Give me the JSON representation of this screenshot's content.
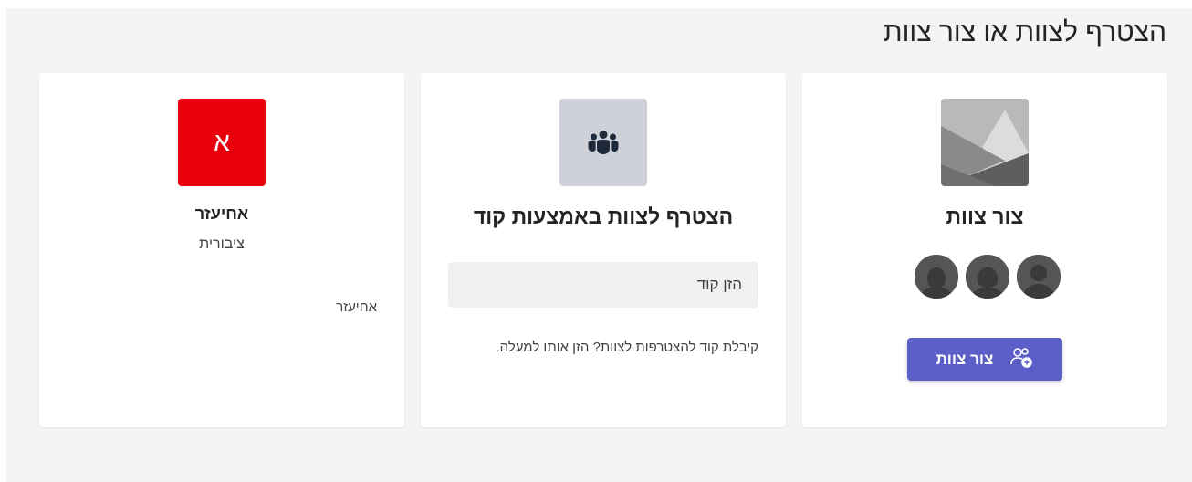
{
  "page": {
    "title": "הצטרף לצוות או צור צוות"
  },
  "create_card": {
    "title": "צור צוות",
    "button_label": "צור צוות",
    "icon": "image-placeholder-icon",
    "button_icon": "people-add-icon"
  },
  "join_card": {
    "title": "הצטרף לצוות באמצעות קוד",
    "input_placeholder": "הזן קוד",
    "input_value": "",
    "hint": "קיבלת קוד להצטרפות לצוות? הזן אותו למעלה.",
    "icon": "people-team-icon"
  },
  "team_card": {
    "initial": "א",
    "name": "אחיעזר",
    "privacy": "ציבורית",
    "description": "אחיעזר",
    "tile_color": "#e8000d"
  },
  "colors": {
    "accent": "#5b5fc7",
    "background": "#f4f4f4"
  }
}
